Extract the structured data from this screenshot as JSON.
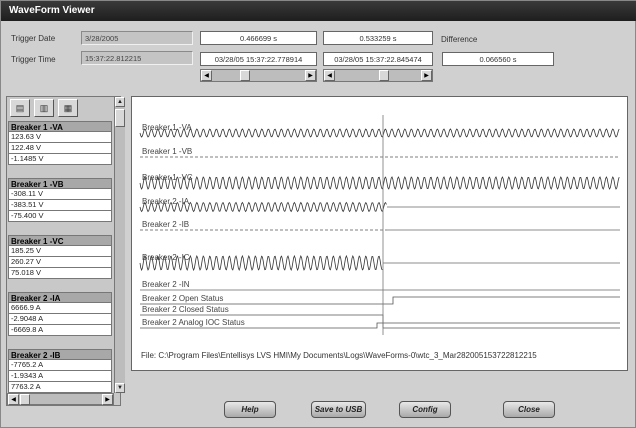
{
  "window": {
    "title": "WaveForm Viewer"
  },
  "header": {
    "trigger_date_label": "Trigger Date",
    "trigger_date_value": "3/28/2005",
    "trigger_time_label": "Trigger Time",
    "trigger_time_value": "15:37:22.812215",
    "cursor1_offset": "0.466699 s",
    "cursor2_offset": "0.533259 s",
    "difference_label": "Difference",
    "cursor1_time": "03/28/05 15:37:22.778914",
    "cursor2_time": "03/28/05 15:37:22.845474",
    "difference_value": "0.066560 s",
    "cursor1_slider_position": 0.33,
    "cursor2_slider_position": 0.57
  },
  "left_panel": {
    "toolbar_icons": [
      "select-channel-icon",
      "settings-icon",
      "copy-icon"
    ],
    "groups": [
      {
        "title": "Breaker  1 -VA",
        "values": [
          "123.63 V",
          "122.48 V",
          "-1.1485 V"
        ]
      },
      {
        "title": "Breaker  1 -VB",
        "values": [
          "-308.11 V",
          "-383.51 V",
          "-75.400 V"
        ]
      },
      {
        "title": "Breaker  1 -VC",
        "values": [
          "185.25 V",
          "260.27 V",
          "75.018 V"
        ]
      },
      {
        "title": "Breaker  2 -IA",
        "values": [
          "6666.9 A",
          "-2.9048 A",
          "-6669.8 A"
        ]
      },
      {
        "title": "Breaker  2 -IB",
        "values": [
          "-7765.2 A",
          "-1.9343 A",
          "7763.2 A"
        ]
      }
    ]
  },
  "plot": {
    "channels": [
      "Breaker  1 -VA",
      "Breaker  1 -VB",
      "Breaker  1 -VC",
      "Breaker  2 -IA",
      "Breaker  2 -IB",
      "Breaker  2 -IC",
      "Breaker  2 -IN",
      "Breaker  2 Open Status",
      "Breaker  2 Closed Status",
      "Breaker  2 Analog IOC Status"
    ],
    "file_path": "File: C:\\Program Files\\Entellisys LVS HMI\\My Documents\\Logs\\WaveForms-0\\wtc_3_Mar282005153722812215"
  },
  "buttons": {
    "help": "Help",
    "save_usb": "Save to USB",
    "config": "Config",
    "close": "Close"
  }
}
